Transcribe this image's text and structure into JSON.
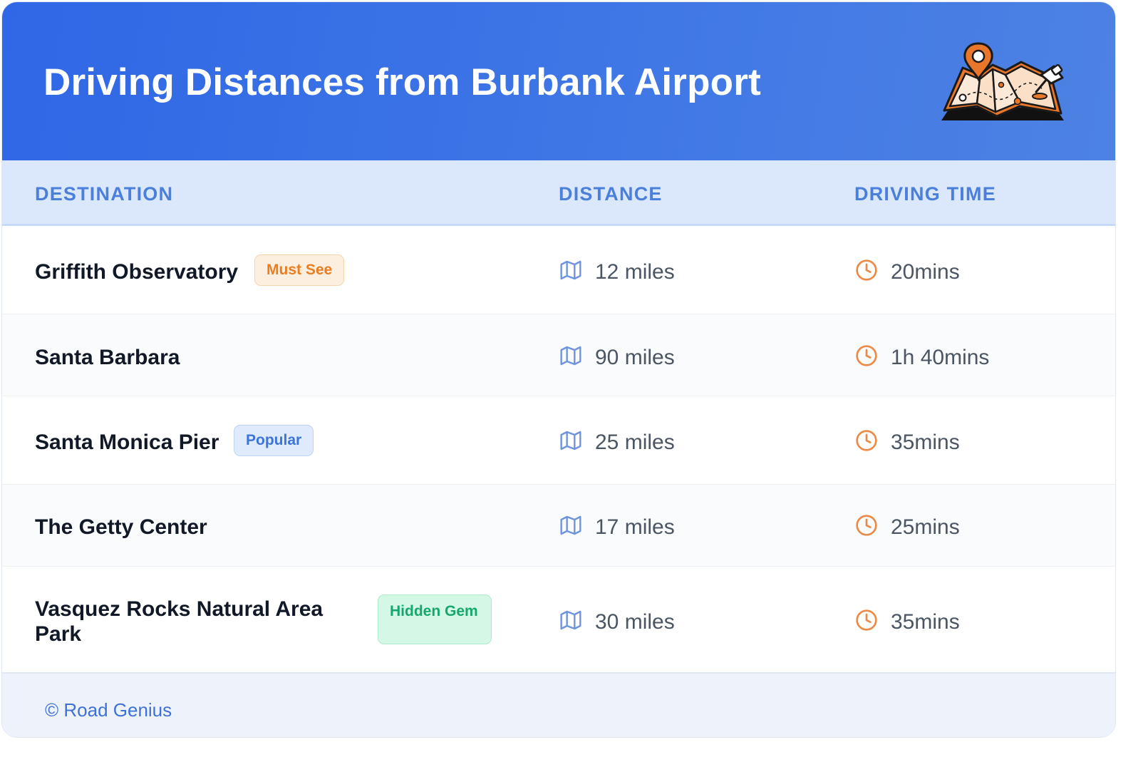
{
  "header": {
    "title": "Driving Distances from Burbank Airport",
    "illustration_icon": "map-with-pins-icon"
  },
  "table": {
    "columns": [
      "DESTINATION",
      "DISTANCE",
      "DRIVING TIME"
    ],
    "rows": [
      {
        "destination": "Griffith Observatory",
        "badge": "Must See",
        "badge_color": "#ea7d22",
        "distance": "12 miles",
        "time": "20mins"
      },
      {
        "destination": "Santa Barbara",
        "badge": "",
        "distance": "90 miles",
        "time": "1h 40mins"
      },
      {
        "destination": "Santa Monica Pier",
        "badge": "Popular",
        "badge_color": "#3d74d8",
        "distance": "25 miles",
        "time": "35mins"
      },
      {
        "destination": "The Getty Center",
        "badge": "",
        "distance": "17 miles",
        "time": "25mins"
      },
      {
        "destination": "Vasquez Rocks Natural Area Park",
        "badge": "Hidden Gem",
        "badge_color": "#16a86a",
        "distance": "30 miles",
        "time": "35mins"
      }
    ],
    "distance_icon": "map-icon",
    "time_icon": "clock-icon"
  },
  "footer": {
    "credit": "© Road Genius"
  },
  "colors": {
    "header_start": "#2f67e6",
    "header_end": "#4d82e3",
    "column_header_text": "#4a7fdc",
    "distance_icon": "#6f94de",
    "time_icon": "#ec8a45"
  }
}
